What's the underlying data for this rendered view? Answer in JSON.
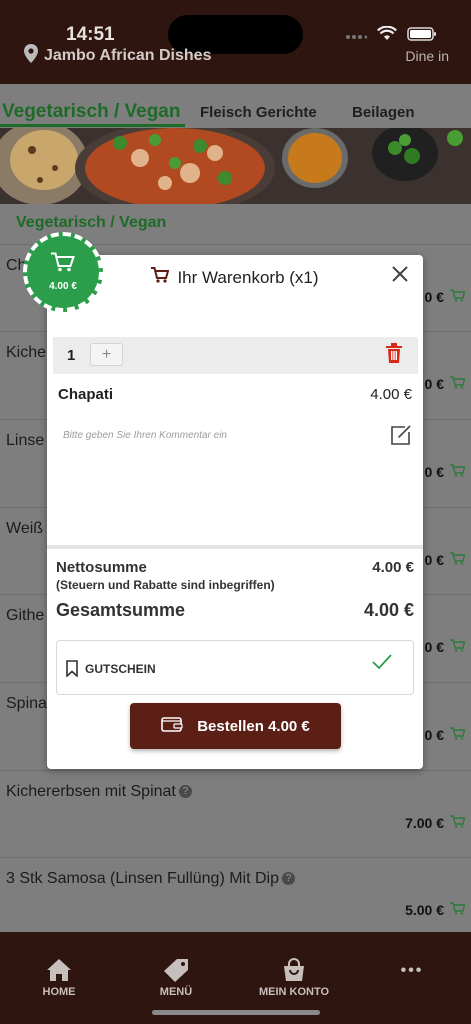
{
  "status_bar": {
    "time": "14:51"
  },
  "header": {
    "restaurant": "Jambo African Dishes",
    "mode": "Dine in"
  },
  "tabs": [
    {
      "label": "Vegetarisch / Vegan"
    },
    {
      "label": "Fleisch Gerichte"
    },
    {
      "label": "Beilagen"
    }
  ],
  "section_title": "Vegetarisch / Vegan",
  "menu_items": [
    {
      "name": "Ch",
      "price": "0 €"
    },
    {
      "name": "Kiche",
      "price": "0 €"
    },
    {
      "name": "Linse",
      "price": "0 €"
    },
    {
      "name": "Weiß",
      "price": "0 €"
    },
    {
      "name": "Githe",
      "price": "0 €"
    },
    {
      "name": "Spina",
      "price": "0 €"
    },
    {
      "name": "Kichererbsen mit Spinat",
      "price": "7.00 €"
    },
    {
      "name": "3 Stk Samosa (Linsen Fullüng) Mit Dip",
      "price": "5.00 €"
    }
  ],
  "cart_badge": {
    "total": "4.00 €"
  },
  "modal": {
    "title": "Ihr Warenkorb (x1)",
    "quantity": "1",
    "plus": "+",
    "item_name": "Chapati",
    "item_price": "4.00 €",
    "comment_placeholder": "Bitte geben Sie Ihren Kommentar ein",
    "netto_label": "Nettosumme",
    "netto_value": "4.00 €",
    "tax_note": "(Steuern und Rabatte sind inbegriffen)",
    "total_label": "Gesamtsumme",
    "total_value": "4.00 €",
    "voucher_label": "GUTSCHEIN",
    "order_button": "Bestellen 4.00 €"
  },
  "bottom_nav": {
    "home": "HOME",
    "menu": "MENÜ",
    "account": "MEIN KONTO",
    "more": "•••"
  },
  "colors": {
    "header_bg": "#2f1510",
    "accent_green": "#1d6b27",
    "badge_green": "#2c9e4b",
    "order_button": "#5b1f16",
    "delete_red": "#d42a1a"
  }
}
